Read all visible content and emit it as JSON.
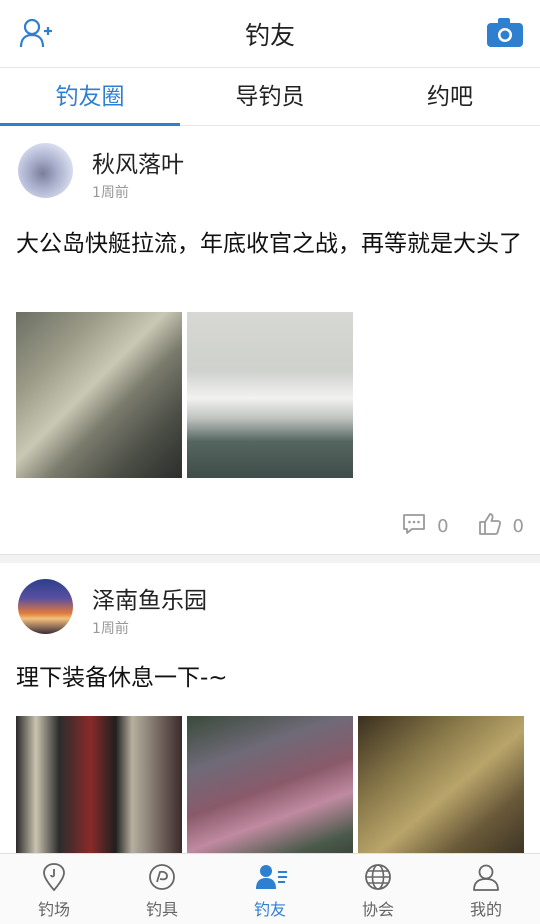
{
  "header": {
    "title": "钓友",
    "left_icon": "add-friend-icon",
    "right_icon": "camera-icon",
    "accent_color": "#2f7fd0"
  },
  "tabs": [
    {
      "label": "钓友圈",
      "active": true
    },
    {
      "label": "导钓员",
      "active": false
    },
    {
      "label": "约吧",
      "active": false
    }
  ],
  "posts": [
    {
      "username": "秋风落叶",
      "time": "1周前",
      "content": "大公岛快艇拉流，年底收官之战，再等就是大头了",
      "comments": "0",
      "likes": "0"
    },
    {
      "username": "泽南鱼乐园",
      "time": "1周前",
      "content": "理下装备休息一下-~"
    }
  ],
  "bottom_nav": [
    {
      "label": "钓场",
      "icon": "location-pin-icon",
      "active": false
    },
    {
      "label": "钓具",
      "icon": "reel-icon",
      "active": false
    },
    {
      "label": "钓友",
      "icon": "friends-icon",
      "active": true
    },
    {
      "label": "协会",
      "icon": "globe-icon",
      "active": false
    },
    {
      "label": "我的",
      "icon": "user-icon",
      "active": false
    }
  ]
}
